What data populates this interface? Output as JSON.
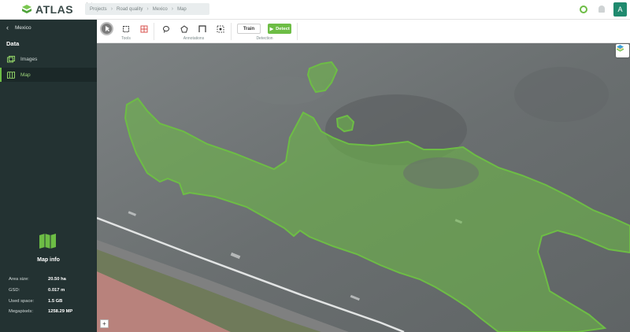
{
  "app": {
    "logo_text": "ATLAS",
    "beta": "beta"
  },
  "breadcrumb": [
    "Projects",
    "Road quality",
    "Mexico",
    "Map"
  ],
  "header": {
    "avatar_letter": "A",
    "help_icon": "help-circle-icon",
    "bell_icon": "bell-icon"
  },
  "sidebar": {
    "back_label": "Mexico",
    "section_title": "Data",
    "items": [
      {
        "label": "Images",
        "icon": "images-icon",
        "active": false
      },
      {
        "label": "Map",
        "icon": "map-icon",
        "active": true
      }
    ],
    "map_info": {
      "title": "Map info",
      "rows": [
        {
          "key": "Area size:",
          "value": "20.50 ha"
        },
        {
          "key": "GSD:",
          "value": "0.017 m"
        },
        {
          "key": "Used space:",
          "value": "1.5 GB"
        },
        {
          "key": "Megapixels:",
          "value": "1258.29 MP"
        }
      ]
    }
  },
  "toolbar": {
    "groups": [
      {
        "label": "Tools"
      },
      {
        "label": "Annotations"
      },
      {
        "label": "Detection"
      }
    ],
    "train_label": "Train",
    "detect_label": "Detect"
  },
  "map": {
    "zoom_in_label": "+",
    "annotation_color": "#6dbd45"
  },
  "colors": {
    "accent": "#6dbd45",
    "sidebar_bg": "#233232",
    "avatar_bg": "#1f8a6e"
  }
}
